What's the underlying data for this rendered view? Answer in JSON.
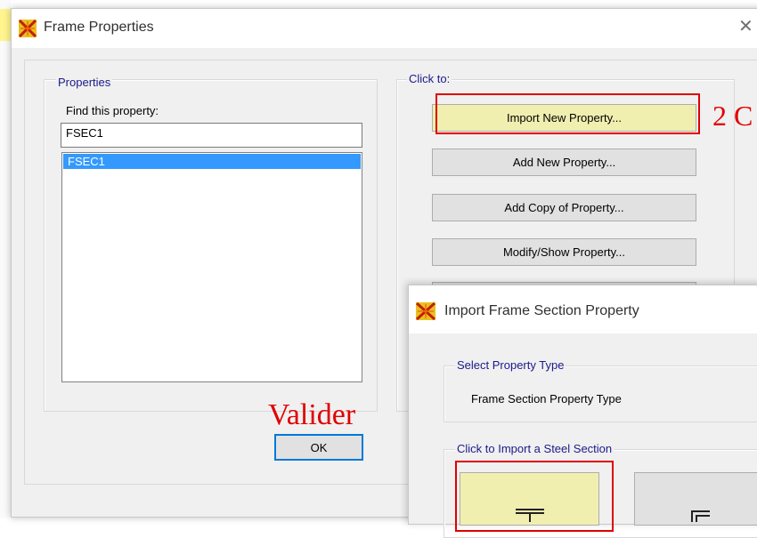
{
  "frame_properties": {
    "title": "Frame Properties",
    "close_glyph": "✕",
    "properties_group": {
      "label": "Properties",
      "find_label": "Find this property:",
      "find_value": "FSEC1",
      "list_items": [
        "FSEC1"
      ]
    },
    "click_to_group": {
      "label": "Click to:",
      "buttons": [
        "Import New Property...",
        "Add New Property...",
        "Add Copy of Property...",
        "Modify/Show Property..."
      ]
    },
    "ok_label": "OK"
  },
  "annotations": {
    "step2": "2 C",
    "valider": "Valider",
    "highlight_color": "#e00000"
  },
  "import_dialog": {
    "title": "Import Frame Section Property",
    "select_type_group": {
      "label": "Select Property Type",
      "type_text": "Frame Section Property Type"
    },
    "steel_group": {
      "label": "Click to Import a Steel Section"
    }
  },
  "icons": {
    "app": "sap2000-app-icon",
    "i_section": "i-section-icon",
    "channel_section": "channel-section-icon"
  }
}
